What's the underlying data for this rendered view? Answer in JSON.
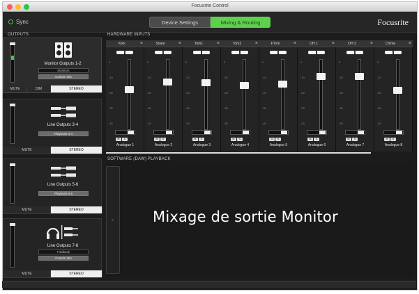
{
  "window": {
    "title": "Focusrite Control"
  },
  "toolbar": {
    "sync_label": "Sync",
    "tabs": [
      {
        "label": "Device Settings",
        "active": false
      },
      {
        "label": "Mixing & Routing",
        "active": true
      }
    ],
    "brand": "Focusrite"
  },
  "colors": {
    "accent": "#5fd04e",
    "background": "#1c1c1c",
    "panel": "#242424"
  },
  "outputs": {
    "header": "OUTPUTS",
    "items": [
      {
        "name": "Monitor Outputs 1-2",
        "source": "Monitors",
        "button": "Custom Mix",
        "icon": "speakers-icon",
        "bar": [
          "MUTE",
          "DIM",
          "STEREO"
        ]
      },
      {
        "name": "Line Outputs 3-4",
        "source": "",
        "button": "Playback 3-4",
        "icon": "cables-icon",
        "bar": [
          "MUTE",
          "STEREO"
        ]
      },
      {
        "name": "Line Outputs 5-6",
        "source": "",
        "button": "Playback 5-6",
        "icon": "cables-icon",
        "bar": [
          "MUTE",
          "STEREO"
        ]
      },
      {
        "name": "Line Outputs 7-8",
        "source": "Foldback",
        "button": "Custom Mix",
        "icon": "headphones-cables-icon",
        "bar": [
          "MUTE",
          "STEREO"
        ]
      }
    ]
  },
  "hardware_inputs": {
    "header": "HARDWARE INPUTS",
    "scale_labels": [
      "0",
      "-10",
      "-20",
      "-30",
      "-40"
    ],
    "strips": [
      {
        "name": "Kick",
        "label": "Analogue 1",
        "level": 0.58
      },
      {
        "name": "Snare",
        "label": "Analogue 2",
        "level": 0.7
      },
      {
        "name": "Tom1",
        "label": "Analogue 3",
        "level": 0.68
      },
      {
        "name": "Tom2",
        "label": "Analogue 4",
        "level": 0.64
      },
      {
        "name": "FTom",
        "label": "Analogue 5",
        "level": 0.66
      },
      {
        "name": "OH 1",
        "label": "Analogue 6",
        "level": 0.78
      },
      {
        "name": "OH 2",
        "label": "Analogue 7",
        "level": 0.78
      },
      {
        "name": "Chime",
        "label": "Analogue 8",
        "level": 0.56
      }
    ]
  },
  "software_playback": {
    "header": "SOFTWARE (DAW) PLAYBACK"
  },
  "overlay_caption": "Mixage de sortie Monitor"
}
